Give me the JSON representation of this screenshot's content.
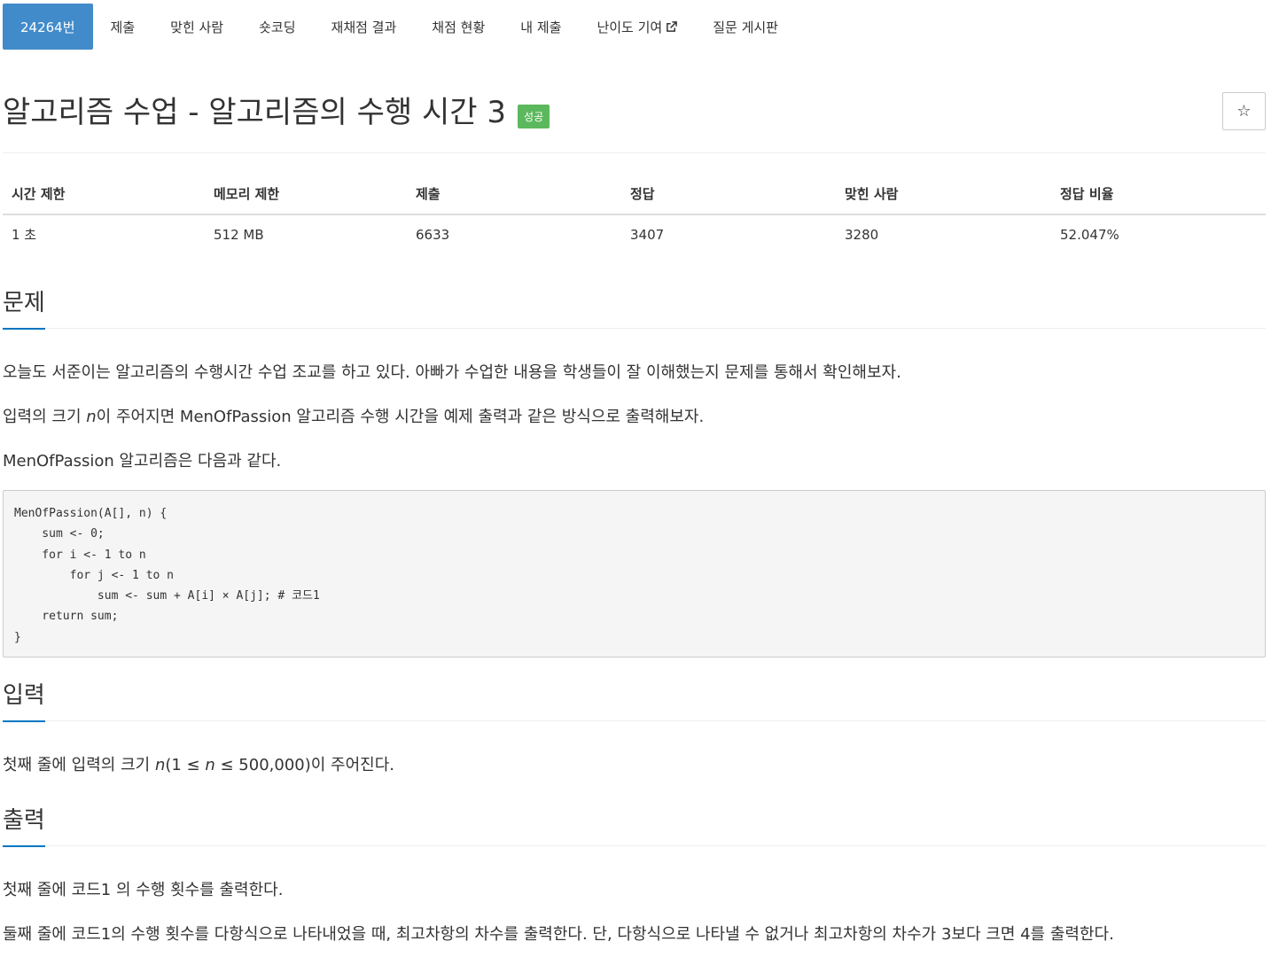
{
  "nav": {
    "tabs": [
      {
        "label": "24264번",
        "active": true
      },
      {
        "label": "제출"
      },
      {
        "label": "맞힌 사람"
      },
      {
        "label": "숏코딩"
      },
      {
        "label": "재채점 결과"
      },
      {
        "label": "채점 현황"
      },
      {
        "label": "내 제출"
      },
      {
        "label": "난이도 기여",
        "icon": "external-link-icon"
      },
      {
        "label": "질문 게시판"
      }
    ]
  },
  "problem": {
    "title": "알고리즘 수업 - 알고리즘의 수행 시간 3",
    "status": "성공",
    "star_icon": "☆"
  },
  "info_table": {
    "headers": [
      "시간 제한",
      "메모리 제한",
      "제출",
      "정답",
      "맞힌 사람",
      "정답 비율"
    ],
    "row": [
      "1 초",
      "512 MB",
      "6633",
      "3407",
      "3280",
      "52.047%"
    ]
  },
  "sections": {
    "description": {
      "heading": "문제",
      "p1": "오늘도 서준이는 알고리즘의 수행시간 수업 조교를 하고 있다. 아빠가 수업한 내용을 학생들이 잘 이해했는지 문제를 통해서 확인해보자.",
      "p2_before": "입력의 크기 ",
      "p2_var": "n",
      "p2_after": "이 주어지면 MenOfPassion 알고리즘 수행 시간을 예제 출력과 같은 방식으로 출력해보자.",
      "p3": "MenOfPassion 알고리즘은 다음과 같다.",
      "code": "MenOfPassion(A[], n) {\n    sum <- 0;\n    for i <- 1 to n\n        for j <- 1 to n\n            sum <- sum + A[i] × A[j]; # 코드1\n    return sum;\n}"
    },
    "input": {
      "heading": "입력",
      "p_before": "첫째 줄에 입력의 크기 ",
      "p_var1": "n",
      "p_mid1": "(1 ≤ ",
      "p_var2": "n",
      "p_after": " ≤ 500,000)이 주어진다."
    },
    "output": {
      "heading": "출력",
      "p1": "첫째 줄에 코드1 의 수행 횟수를 출력한다.",
      "p2": "둘째 줄에 코드1의 수행 횟수를 다항식으로 나타내었을 때, 최고차항의 차수를 출력한다. 단, 다항식으로 나타낼 수 없거나 최고차항의 차수가 3보다 크면 4를 출력한다."
    }
  },
  "colors": {
    "active_tab": "#428bca",
    "status_success": "#5cb85c",
    "heading_underline": "#0076c0",
    "code_bg": "#f5f5f5"
  }
}
